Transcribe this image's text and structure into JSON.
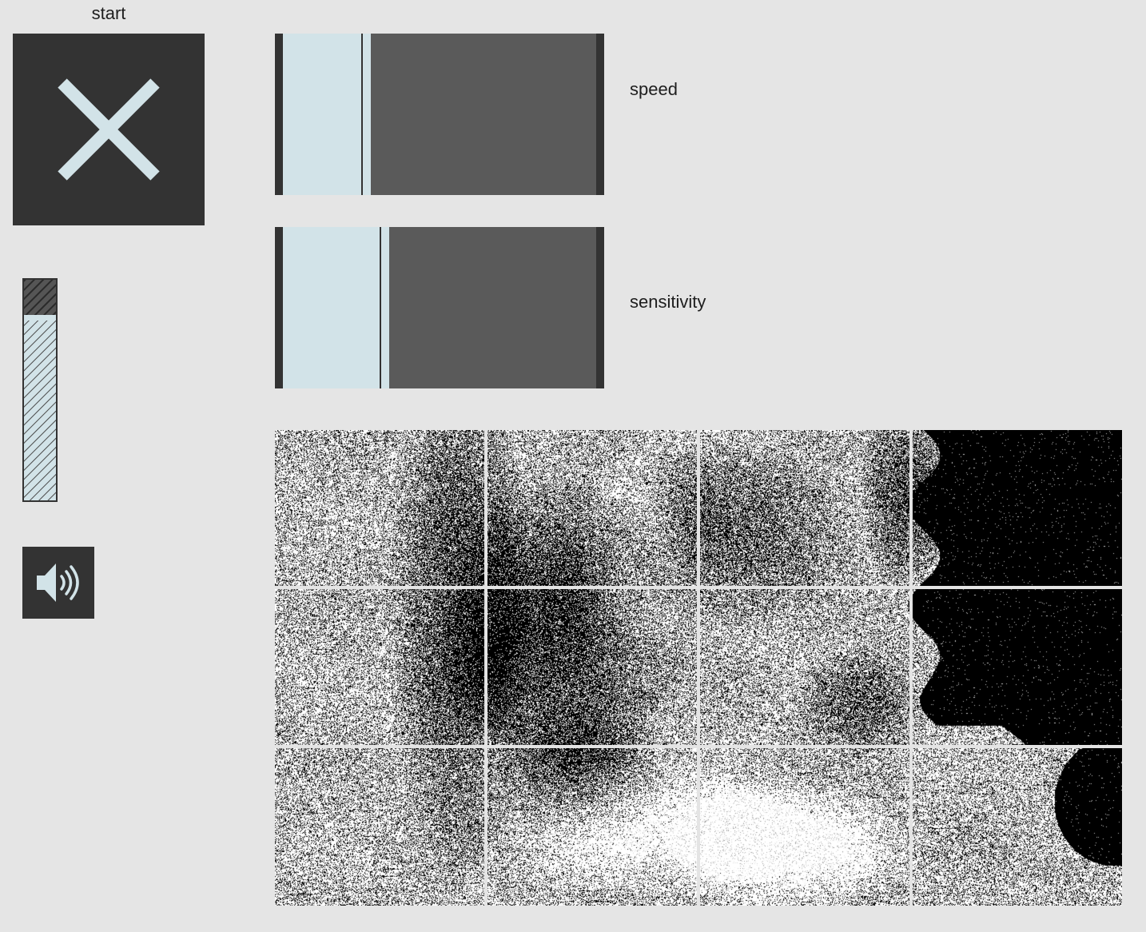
{
  "start": {
    "label": "start",
    "icon": "close-icon",
    "active": true
  },
  "sliders": [
    {
      "id": "speed",
      "label": "speed",
      "value": 0.28
    },
    {
      "id": "sensitivity",
      "label": "sensitivity",
      "value": 0.34
    }
  ],
  "meter": {
    "level": 0.84,
    "icon": "hatched-level-meter"
  },
  "sound": {
    "icon": "speaker-volume-icon"
  },
  "video": {
    "rows": 3,
    "cols": 4,
    "content": "motion-threshold-image"
  },
  "colors": {
    "background": "#e5e5e5",
    "dark": "#333333",
    "accent": "#d2e3e8",
    "track": "#5a5a5a"
  }
}
